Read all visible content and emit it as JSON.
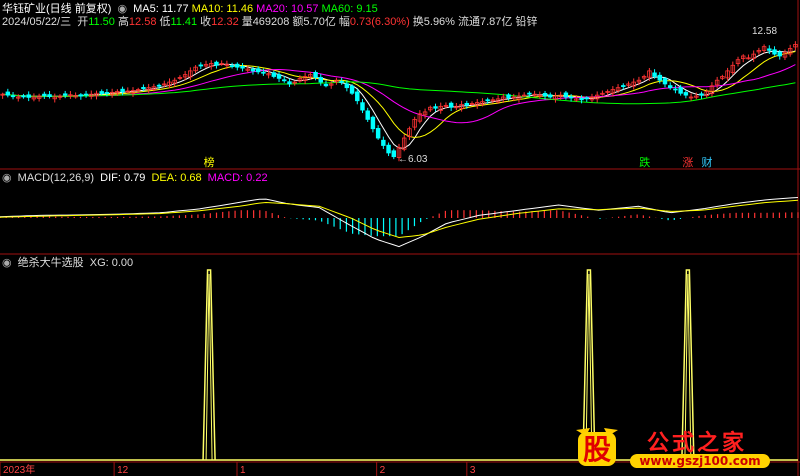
{
  "header": {
    "stock_name": "华钰矿业(日线 前复权)",
    "ma_labels": [
      {
        "text": "MA5: 11.77",
        "color": "#ffffff"
      },
      {
        "text": "MA10: 11.46",
        "color": "#ffff00"
      },
      {
        "text": "MA20: 10.57",
        "color": "#ff00ff"
      },
      {
        "text": "MA60: 9.15",
        "color": "#00ff00"
      }
    ],
    "quote_date": "2024/05/22/三",
    "quote": [
      {
        "label": "开",
        "value": "11.50",
        "color": "#00ff00"
      },
      {
        "label": "高",
        "value": "12.58",
        "color": "#ff3333"
      },
      {
        "label": "低",
        "value": "11.41",
        "color": "#00ff00"
      },
      {
        "label": "收",
        "value": "12.32",
        "color": "#ff3333"
      },
      {
        "label": "量",
        "value": "469208",
        "color": "#dddddd"
      },
      {
        "label": "额",
        "value": "5.70亿",
        "color": "#dddddd"
      },
      {
        "label": "幅",
        "value": "0.73(6.30%)",
        "color": "#ff3333"
      },
      {
        "label": "换",
        "value": "5.96%",
        "color": "#dddddd"
      },
      {
        "label": "流通",
        "value": "7.87亿",
        "color": "#dddddd"
      },
      {
        "label": "铅锌",
        "value": "",
        "color": "#dddddd"
      }
    ]
  },
  "macd_header": {
    "name": "MACD(12,26,9)",
    "dif": "DIF: 0.79",
    "dea": "DEA: 0.68",
    "macd": "MACD: 0.22"
  },
  "xg_header": {
    "name": "绝杀大牛选股",
    "xg": "XG: 0.00"
  },
  "x_axis_labels": [
    {
      "text": "2023年",
      "pos": 0
    },
    {
      "text": "12",
      "pos": 0.143
    },
    {
      "text": "1",
      "pos": 0.297
    },
    {
      "text": "2",
      "pos": 0.472
    },
    {
      "text": "3",
      "pos": 0.585
    }
  ],
  "event_markers": [
    {
      "text": "榜",
      "color": "#ffff00",
      "pos": 0.262
    },
    {
      "text": "跌",
      "color": "#00ff00",
      "pos": 0.808
    },
    {
      "text": "涨",
      "color": "#ff3333",
      "pos": 0.862
    },
    {
      "text": "财",
      "color": "#33ccff",
      "pos": 0.886
    }
  ],
  "annotations": {
    "high": "12.58",
    "low": "6.03"
  },
  "logo": {
    "char": "股",
    "text": "公式之家",
    "url": "www.gszj100.com"
  },
  "colors": {
    "up": "#ff3333",
    "down": "#00ffff",
    "ma5": "#ffffff",
    "ma10": "#ffff00",
    "ma20": "#ff00ff",
    "ma60": "#00ff00",
    "dif": "#ffffff",
    "dea": "#ffff00",
    "grid": "#a01010",
    "xg": "#ffff66"
  },
  "chart_data": [
    {
      "type": "candlestick",
      "title": "华钰矿业(日线 前复权)",
      "ylim": [
        5.8,
        13.2
      ],
      "close": [
        9.65,
        9.6,
        9.55,
        9.5,
        9.52,
        9.48,
        9.5,
        9.55,
        9.58,
        9.52,
        9.5,
        9.55,
        9.6,
        9.62,
        9.58,
        9.55,
        9.6,
        9.65,
        9.7,
        9.68,
        9.72,
        9.75,
        9.8,
        9.78,
        9.82,
        9.85,
        9.9,
        9.95,
        10.0,
        10.05,
        10.1,
        10.2,
        10.3,
        10.4,
        10.55,
        10.7,
        10.9,
        11.1,
        11.2,
        11.25,
        11.3,
        11.2,
        11.3,
        11.25,
        11.15,
        11.1,
        11.05,
        11.0,
        10.9,
        10.85,
        10.8,
        10.75,
        10.6,
        10.5,
        10.4,
        10.2,
        10.3,
        10.5,
        10.6,
        10.7,
        10.55,
        10.3,
        10.1,
        10.2,
        10.4,
        10.3,
        10.0,
        9.7,
        9.3,
        8.8,
        8.3,
        7.8,
        7.3,
        6.9,
        6.5,
        6.3,
        6.8,
        7.3,
        7.8,
        8.3,
        8.6,
        8.7,
        8.95,
        8.9,
        9.0,
        9.05,
        8.95,
        9.0,
        9.1,
        9.05,
        9.15,
        9.2,
        9.25,
        9.3,
        9.35,
        9.4,
        9.5,
        9.45,
        9.5,
        9.55,
        9.6,
        9.7,
        9.65,
        9.6,
        9.55,
        9.5,
        9.55,
        9.6,
        9.5,
        9.45,
        9.4,
        9.35,
        9.4,
        9.5,
        9.6,
        9.7,
        9.8,
        9.9,
        10.0,
        10.1,
        10.2,
        10.3,
        10.4,
        10.6,
        10.9,
        10.6,
        10.4,
        10.2,
        10.0,
        9.9,
        9.7,
        9.6,
        9.5,
        9.55,
        9.6,
        9.8,
        10.1,
        10.4,
        10.6,
        10.9,
        11.2,
        11.5,
        11.7,
        11.6,
        11.8,
        12.0,
        12.2,
        12.0,
        11.8,
        11.7,
        11.9,
        12.1,
        12.32
      ]
    },
    {
      "type": "area",
      "title": "MACD(12,26,9)",
      "x": [
        0,
        0.05,
        0.1,
        0.15,
        0.2,
        0.25,
        0.3,
        0.33,
        0.36,
        0.4,
        0.44,
        0.47,
        0.5,
        0.53,
        0.56,
        0.6,
        0.65,
        0.7,
        0.75,
        0.8,
        0.84,
        0.88,
        0.92,
        0.96,
        1.0
      ],
      "series": [
        {
          "name": "DIF",
          "values": [
            0.05,
            0.1,
            0.12,
            0.15,
            0.2,
            0.35,
            0.6,
            0.75,
            0.55,
            0.4,
            -0.3,
            -0.8,
            -1.1,
            -0.7,
            -0.2,
            0.1,
            0.3,
            0.5,
            0.3,
            0.45,
            0.2,
            0.35,
            0.55,
            0.7,
            0.79
          ]
        },
        {
          "name": "DEA",
          "values": [
            0.03,
            0.07,
            0.1,
            0.13,
            0.17,
            0.28,
            0.45,
            0.6,
            0.55,
            0.45,
            0.0,
            -0.45,
            -0.75,
            -0.65,
            -0.35,
            -0.05,
            0.18,
            0.35,
            0.32,
            0.38,
            0.25,
            0.3,
            0.45,
            0.6,
            0.68
          ]
        },
        {
          "name": "MACD",
          "values": [
            0.04,
            0.06,
            0.04,
            0.04,
            0.06,
            0.14,
            0.3,
            0.3,
            0.0,
            -0.1,
            -0.6,
            -0.7,
            -0.7,
            -0.1,
            0.3,
            0.3,
            0.24,
            0.3,
            -0.04,
            0.14,
            -0.1,
            0.1,
            0.2,
            0.2,
            0.22
          ]
        }
      ]
    },
    {
      "type": "line",
      "title": "绝杀大牛选股",
      "series": [
        {
          "name": "XG",
          "values": [
            0.0
          ]
        }
      ],
      "spikes": [
        0.262,
        0.738,
        0.862
      ],
      "ylim": [
        0,
        1
      ]
    }
  ]
}
